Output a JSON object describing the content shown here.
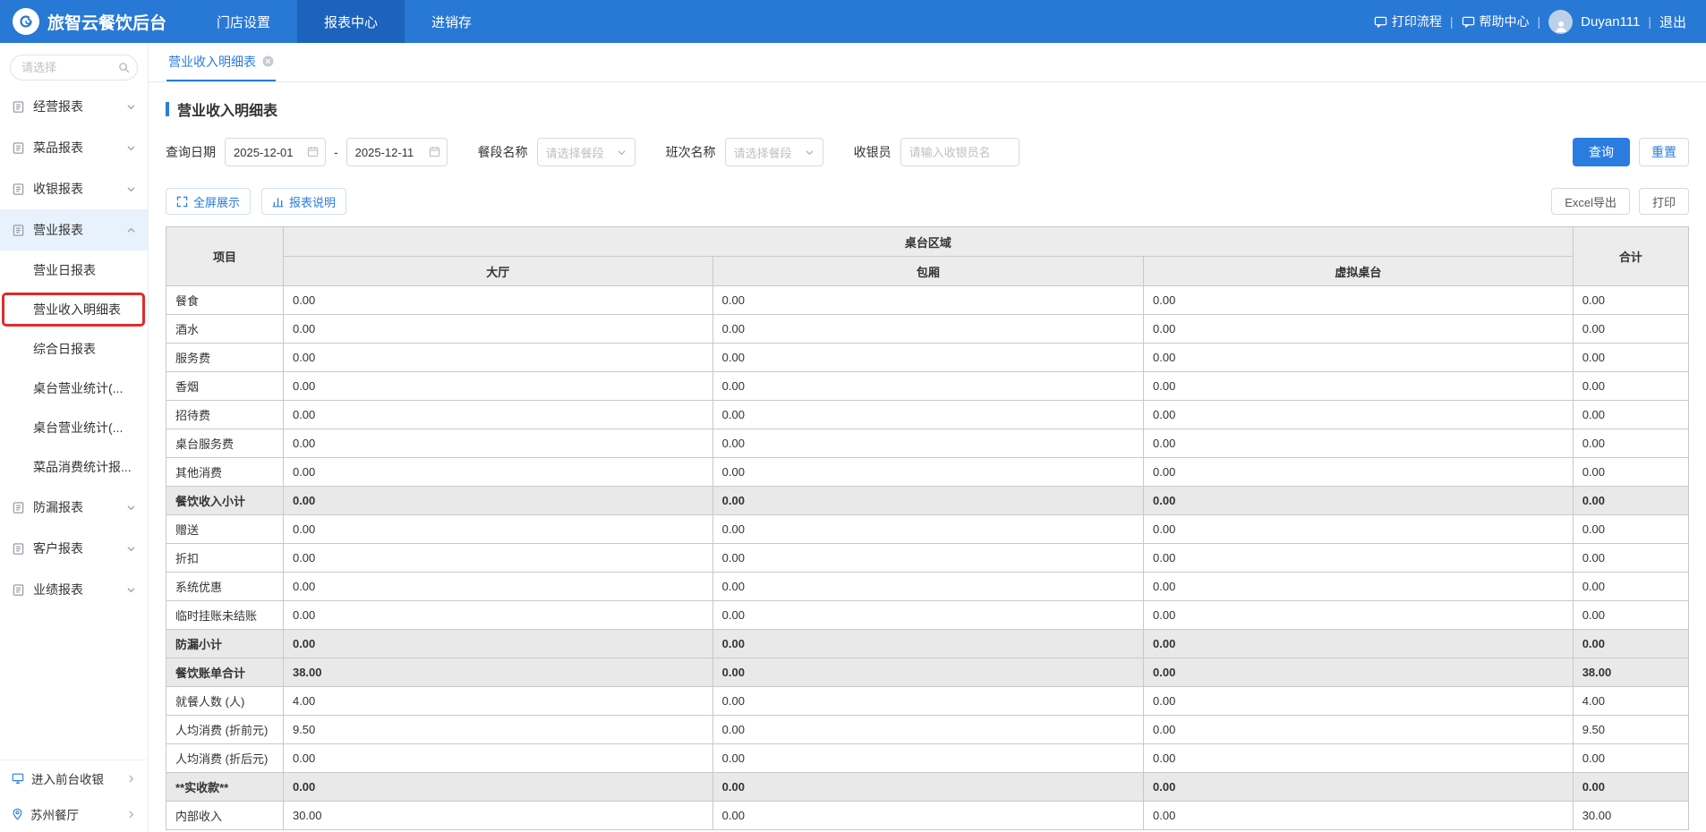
{
  "navbar": {
    "brand": "旅智云餐饮后台",
    "items": [
      {
        "label": "门店设置",
        "active": false
      },
      {
        "label": "报表中心",
        "active": true
      },
      {
        "label": "进销存",
        "active": false
      }
    ],
    "right": {
      "print": "打印流程",
      "help": "帮助中心",
      "username": "Duyan111",
      "logout": "退出"
    }
  },
  "sidebar": {
    "search_placeholder": "请选择",
    "menu": [
      {
        "label": "经营报表",
        "state": "collapsed"
      },
      {
        "label": "菜品报表",
        "state": "collapsed"
      },
      {
        "label": "收银报表",
        "state": "collapsed"
      },
      {
        "label": "营业报表",
        "state": "expanded",
        "active": true,
        "children": [
          {
            "label": "营业日报表",
            "selected": false
          },
          {
            "label": "营业收入明细表",
            "selected": true
          },
          {
            "label": "综合日报表",
            "selected": false
          },
          {
            "label": "桌台营业统计(...",
            "selected": false
          },
          {
            "label": "桌台营业统计(...",
            "selected": false
          },
          {
            "label": "菜品消费统计报...",
            "selected": false
          }
        ]
      },
      {
        "label": "防漏报表",
        "state": "collapsed"
      },
      {
        "label": "客户报表",
        "state": "collapsed"
      },
      {
        "label": "业绩报表",
        "state": "collapsed"
      }
    ],
    "footer": [
      {
        "label": "进入前台收银"
      },
      {
        "label": "苏州餐厅"
      }
    ]
  },
  "tab": {
    "label": "营业收入明细表"
  },
  "page": {
    "title": "营业收入明细表"
  },
  "filters": {
    "date_label": "查询日期",
    "date_from": "2025-12-01",
    "date_to": "2025-12-11",
    "meal_label": "餐段名称",
    "meal_placeholder": "请选择餐段",
    "shift_label": "班次名称",
    "shift_placeholder": "请选择餐段",
    "cashier_label": "收银员",
    "cashier_placeholder": "请输入收银员名",
    "query_button": "查询",
    "reset_button": "重置"
  },
  "toolbar": {
    "fullscreen": "全屏展示",
    "report_note": "报表说明",
    "excel_export": "Excel导出",
    "print": "打印"
  },
  "table": {
    "col_item": "项目",
    "group_header": "桌台区域",
    "col_total": "合计",
    "area_columns": [
      "大厅",
      "包厢",
      "虚拟桌台"
    ],
    "rows": [
      {
        "label": "餐食",
        "values": [
          "0.00",
          "0.00",
          "0.00",
          "0.00"
        ],
        "emphasis": false
      },
      {
        "label": "酒水",
        "values": [
          "0.00",
          "0.00",
          "0.00",
          "0.00"
        ],
        "emphasis": false
      },
      {
        "label": "服务费",
        "values": [
          "0.00",
          "0.00",
          "0.00",
          "0.00"
        ],
        "emphasis": false
      },
      {
        "label": "香烟",
        "values": [
          "0.00",
          "0.00",
          "0.00",
          "0.00"
        ],
        "emphasis": false
      },
      {
        "label": "招待费",
        "values": [
          "0.00",
          "0.00",
          "0.00",
          "0.00"
        ],
        "emphasis": false
      },
      {
        "label": "桌台服务费",
        "values": [
          "0.00",
          "0.00",
          "0.00",
          "0.00"
        ],
        "emphasis": false
      },
      {
        "label": "其他消费",
        "values": [
          "0.00",
          "0.00",
          "0.00",
          "0.00"
        ],
        "emphasis": false
      },
      {
        "label": "餐饮收入小计",
        "values": [
          "0.00",
          "0.00",
          "0.00",
          "0.00"
        ],
        "emphasis": true
      },
      {
        "label": "赠送",
        "values": [
          "0.00",
          "0.00",
          "0.00",
          "0.00"
        ],
        "emphasis": false
      },
      {
        "label": "折扣",
        "values": [
          "0.00",
          "0.00",
          "0.00",
          "0.00"
        ],
        "emphasis": false
      },
      {
        "label": "系统优惠",
        "values": [
          "0.00",
          "0.00",
          "0.00",
          "0.00"
        ],
        "emphasis": false
      },
      {
        "label": "临时挂账未结账",
        "values": [
          "0.00",
          "0.00",
          "0.00",
          "0.00"
        ],
        "emphasis": false
      },
      {
        "label": "防漏小计",
        "values": [
          "0.00",
          "0.00",
          "0.00",
          "0.00"
        ],
        "emphasis": true
      },
      {
        "label": "餐饮账单合计",
        "values": [
          "38.00",
          "0.00",
          "0.00",
          "38.00"
        ],
        "emphasis": true
      },
      {
        "label": "就餐人数 (人)",
        "values": [
          "4.00",
          "0.00",
          "0.00",
          "4.00"
        ],
        "emphasis": false
      },
      {
        "label": "人均消费 (折前元)",
        "values": [
          "9.50",
          "0.00",
          "0.00",
          "9.50"
        ],
        "emphasis": false
      },
      {
        "label": "人均消费 (折后元)",
        "values": [
          "0.00",
          "0.00",
          "0.00",
          "0.00"
        ],
        "emphasis": false
      },
      {
        "label": "**实收款**",
        "values": [
          "0.00",
          "0.00",
          "0.00",
          "0.00"
        ],
        "emphasis": true
      },
      {
        "label": "内部收入",
        "values": [
          "30.00",
          "0.00",
          "0.00",
          "30.00"
        ],
        "emphasis": false
      }
    ]
  },
  "colors": {
    "navbar": "#2878d6",
    "navbar_active": "#1c63bd",
    "accent": "#2a7ce0",
    "annotation_red": "#e12a2a",
    "header_bg": "#ececec",
    "emphasis_row_bg": "#e9e9e9"
  }
}
